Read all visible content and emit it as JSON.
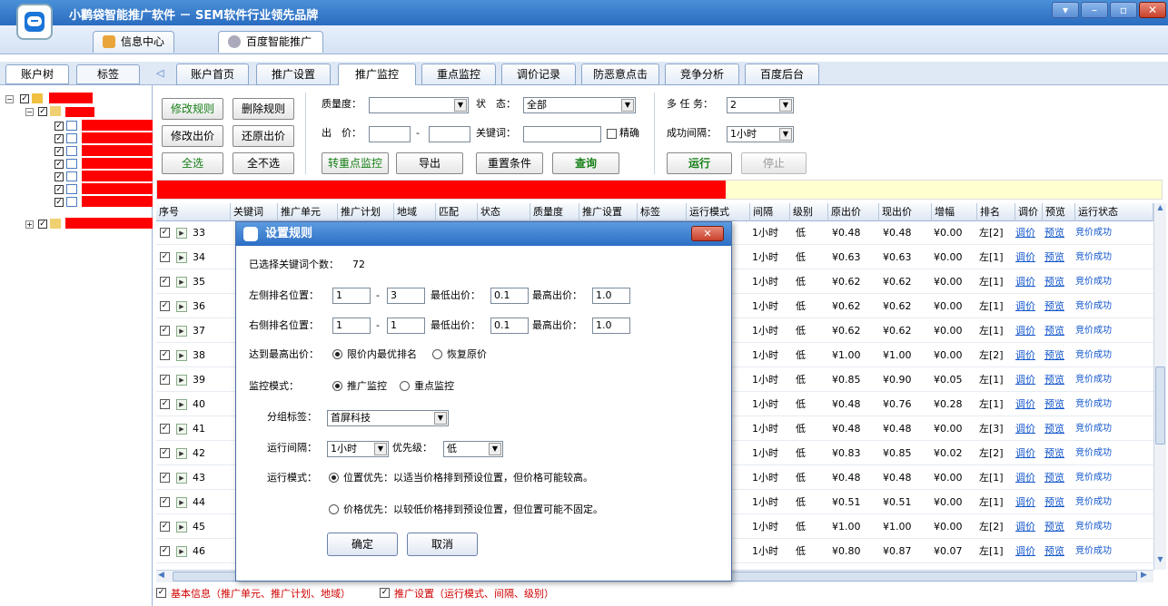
{
  "app": {
    "title": "小鹳袋智能推广软件 － SEM软件行业领先品牌"
  },
  "top_tabs": [
    {
      "label": "信息中心"
    },
    {
      "label": "百度智能推广"
    }
  ],
  "left_tabs": [
    {
      "label": "账户树"
    },
    {
      "label": "标签"
    }
  ],
  "main_tabs": [
    {
      "label": "账户首页"
    },
    {
      "label": "推广设置"
    },
    {
      "label": "推广监控"
    },
    {
      "label": "重点监控"
    },
    {
      "label": "调价记录"
    },
    {
      "label": "防恶意点击"
    },
    {
      "label": "竞争分析"
    },
    {
      "label": "百度后台"
    }
  ],
  "toolbar": {
    "modify_rule": "修改规则",
    "delete_rule": "删除规则",
    "modify_bid": "修改出价",
    "restore_bid": "还原出价",
    "select_all": "全选",
    "select_none": "全不选",
    "quality_label": "质量度：",
    "quality_value": "",
    "status_label": "状　态：",
    "status_value": "全部",
    "price_label": "出　价：",
    "price_min": "",
    "price_dash": "-",
    "price_max": "",
    "keyword_label": "关键词：",
    "keyword_value": "",
    "exact_label": "精确",
    "to_key_monitor": "转重点监控",
    "export": "导出",
    "reset": "重置条件",
    "query": "查询",
    "multitask_label": "多 任 务：",
    "multitask_value": "2",
    "interval_label": "成功间隔：",
    "interval_value": "1小时",
    "run": "运行",
    "stop": "停止"
  },
  "progress": {
    "fraction": 0.566
  },
  "columns": [
    {
      "label": "序号"
    },
    {
      "label": "关键词"
    },
    {
      "label": "推广单元"
    },
    {
      "label": "推广计划"
    },
    {
      "label": "地域"
    },
    {
      "label": "匹配"
    },
    {
      "label": "状态"
    },
    {
      "label": "质量度"
    },
    {
      "label": "推广设置"
    },
    {
      "label": "标签"
    },
    {
      "label": "运行模式"
    },
    {
      "label": "间隔"
    },
    {
      "label": "级别"
    },
    {
      "label": "原出价"
    },
    {
      "label": "现出价"
    },
    {
      "label": "增幅"
    },
    {
      "label": "排名"
    },
    {
      "label": "调价"
    },
    {
      "label": "预览"
    },
    {
      "label": "运行状态"
    }
  ],
  "rows": [
    {
      "no": "33",
      "interval": "1小时",
      "level": "低",
      "orig": "¥0.48",
      "cur": "¥0.48",
      "inc": "¥0.00",
      "rank": "左[2]",
      "adjust": "调价",
      "preview": "预览",
      "state": "竞价成功"
    },
    {
      "no": "34",
      "interval": "1小时",
      "level": "低",
      "orig": "¥0.63",
      "cur": "¥0.63",
      "inc": "¥0.00",
      "rank": "左[1]",
      "adjust": "调价",
      "preview": "预览",
      "state": "竞价成功"
    },
    {
      "no": "35",
      "interval": "1小时",
      "level": "低",
      "orig": "¥0.62",
      "cur": "¥0.62",
      "inc": "¥0.00",
      "rank": "左[1]",
      "adjust": "调价",
      "preview": "预览",
      "state": "竞价成功"
    },
    {
      "no": "36",
      "interval": "1小时",
      "level": "低",
      "orig": "¥0.62",
      "cur": "¥0.62",
      "inc": "¥0.00",
      "rank": "左[1]",
      "adjust": "调价",
      "preview": "预览",
      "state": "竞价成功"
    },
    {
      "no": "37",
      "interval": "1小时",
      "level": "低",
      "orig": "¥0.62",
      "cur": "¥0.62",
      "inc": "¥0.00",
      "rank": "左[1]",
      "adjust": "调价",
      "preview": "预览",
      "state": "竞价成功"
    },
    {
      "no": "38",
      "interval": "1小时",
      "level": "低",
      "orig": "¥1.00",
      "cur": "¥1.00",
      "inc": "¥0.00",
      "rank": "左[2]",
      "adjust": "调价",
      "preview": "预览",
      "state": "竞价成功"
    },
    {
      "no": "39",
      "interval": "1小时",
      "level": "低",
      "orig": "¥0.85",
      "cur": "¥0.90",
      "inc": "¥0.05",
      "rank": "左[1]",
      "adjust": "调价",
      "preview": "预览",
      "state": "竞价成功"
    },
    {
      "no": "40",
      "interval": "1小时",
      "level": "低",
      "orig": "¥0.48",
      "cur": "¥0.76",
      "inc": "¥0.28",
      "rank": "左[1]",
      "adjust": "调价",
      "preview": "预览",
      "state": "竞价成功"
    },
    {
      "no": "41",
      "interval": "1小时",
      "level": "低",
      "orig": "¥0.48",
      "cur": "¥0.48",
      "inc": "¥0.00",
      "rank": "左[3]",
      "adjust": "调价",
      "preview": "预览",
      "state": "竞价成功"
    },
    {
      "no": "42",
      "interval": "1小时",
      "level": "低",
      "orig": "¥0.83",
      "cur": "¥0.85",
      "inc": "¥0.02",
      "rank": "左[2]",
      "adjust": "调价",
      "preview": "预览",
      "state": "竞价成功"
    },
    {
      "no": "43",
      "interval": "1小时",
      "level": "低",
      "orig": "¥0.48",
      "cur": "¥0.48",
      "inc": "¥0.00",
      "rank": "左[1]",
      "adjust": "调价",
      "preview": "预览",
      "state": "竞价成功"
    },
    {
      "no": "44",
      "interval": "1小时",
      "level": "低",
      "orig": "¥0.51",
      "cur": "¥0.51",
      "inc": "¥0.00",
      "rank": "左[1]",
      "adjust": "调价",
      "preview": "预览",
      "state": "竞价成功"
    },
    {
      "no": "45",
      "interval": "1小时",
      "level": "低",
      "orig": "¥1.00",
      "cur": "¥1.00",
      "inc": "¥0.00",
      "rank": "左[2]",
      "adjust": "调价",
      "preview": "预览",
      "state": "竞价成功"
    },
    {
      "no": "46",
      "interval": "1小时",
      "level": "低",
      "orig": "¥0.80",
      "cur": "¥0.87",
      "inc": "¥0.07",
      "rank": "左[1]",
      "adjust": "调价",
      "preview": "预览",
      "state": "竞价成功"
    }
  ],
  "footer": {
    "basic": "基本信息（推广单元、推广计划、地域）",
    "settings": "推广设置（运行模式、间隔、级别）"
  },
  "dialog": {
    "title": "设置规则",
    "selected_label": "已选择关键词个数：",
    "selected_count": "72",
    "left_rank_label": "左侧排名位置：",
    "left_from": "1",
    "left_to": "3",
    "right_rank_label": "右侧排名位置：",
    "right_from": "1",
    "right_to": "1",
    "dash": "-",
    "min_bid_label": "最低出价：",
    "max_bid_label": "最高出价：",
    "left_min": "0.1",
    "left_max": "1.0",
    "right_min": "0.1",
    "right_max": "1.0",
    "reach_max_label": "达到最高出价：",
    "reach_opt1": "限价内最优排名",
    "reach_opt2": "恢复原价",
    "monitor_label": "监控模式：",
    "monitor_opt1": "推广监控",
    "monitor_opt2": "重点监控",
    "group_label": "分组标签：",
    "group_value": "首屏科技",
    "interval_label": "运行间隔：",
    "interval_value": "1小时",
    "priority_label": "优先级：",
    "priority_value": "低",
    "mode_label": "运行模式：",
    "mode_opt1": "位置优先：以适当价格排到预设位置，但价格可能较高。",
    "mode_opt2": "价格优先：以较低价格排到预设位置，但位置可能不固定。",
    "ok": "确定",
    "cancel": "取消"
  },
  "colors": {
    "accent": "#2a6cc0",
    "redaction": "#ff0000",
    "link": "#1155cc",
    "green_text": "#188018"
  }
}
